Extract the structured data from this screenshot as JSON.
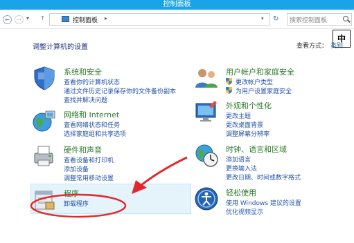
{
  "window": {
    "title": "控制面板"
  },
  "address": {
    "back_glyph": "←",
    "forward_glyph": "→",
    "recent_glyph": "▾",
    "up_glyph": "↑",
    "path_label": "控制面板",
    "path_sep": "▸",
    "dropdown_glyph": "▾",
    "refresh_glyph": "↻",
    "search_placeholder": "搜索控制面板"
  },
  "ime_indicator": "中",
  "page": {
    "title": "调整计算机的设置",
    "view_by_label": "查看方式：",
    "view_by_value": "类别"
  },
  "categories": [
    {
      "title": "系统和安全",
      "icon": "shield-system-icon",
      "links": [
        "查看你的计算机状态",
        "通过文件历史记录保存你的文件备份副本",
        "查找并解决问题"
      ]
    },
    {
      "title": "网络和 Internet",
      "icon": "network-globe-icon",
      "links": [
        "查看网络状态和任务",
        "选择家庭组和共享选项"
      ]
    },
    {
      "title": "硬件和声音",
      "icon": "printer-hardware-icon",
      "links": [
        "查看设备和打印机",
        "添加设备",
        "调整常用移动设置"
      ]
    },
    {
      "title": "程序",
      "icon": "programs-icon",
      "links": [
        "卸载程序"
      ]
    },
    {
      "title": "用户帐户和家庭安全",
      "icon": "users-icon",
      "links": [
        "更改帐户类型",
        "为用户设置家庭安全"
      ]
    },
    {
      "title": "外观和个性化",
      "icon": "appearance-icon",
      "links": [
        "更改主题",
        "更改桌面背景",
        "调整屏幕分辨率"
      ]
    },
    {
      "title": "时钟、语言和区域",
      "icon": "clock-globe-icon",
      "links": [
        "添加语言",
        "更换输入法",
        "更改日期、时间或数字格式"
      ]
    },
    {
      "title": "轻松使用",
      "icon": "ease-of-access-icon",
      "links": [
        "使用 Windows 建议的设置",
        "优化视频显示"
      ]
    }
  ],
  "colors": {
    "titlebar": "#1aa3e6",
    "category_title": "#2c7a2c",
    "link": "#2352a6",
    "annotation": "#e2282b"
  }
}
